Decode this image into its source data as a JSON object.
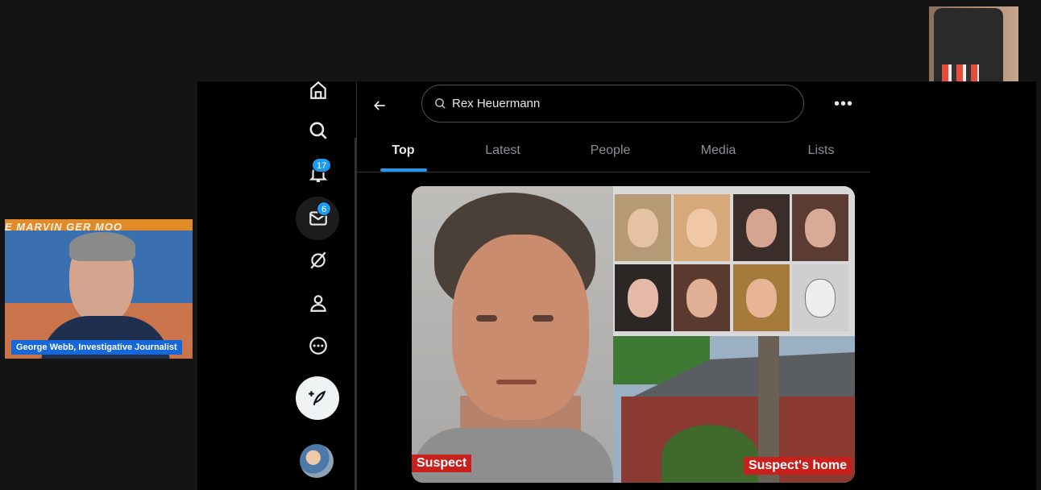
{
  "webcam": {
    "label": "George Webb, Investigative Journalist",
    "poster_text": "E MARVIN GER MOO"
  },
  "nav": {
    "notifications_badge": "17",
    "messages_badge": "6"
  },
  "search": {
    "value": "Rex Heuermann"
  },
  "more_label": "•••",
  "tabs": [
    {
      "label": "Top",
      "active": true
    },
    {
      "label": "Latest",
      "active": false
    },
    {
      "label": "People",
      "active": false
    },
    {
      "label": "Media",
      "active": false
    },
    {
      "label": "Lists",
      "active": false
    }
  ],
  "media": {
    "caption_left": "Suspect",
    "caption_right": "Suspect's home"
  },
  "colors": {
    "accent": "#1d9bf0",
    "caption_red": "#c8201d",
    "label_blue": "#1668d9"
  }
}
